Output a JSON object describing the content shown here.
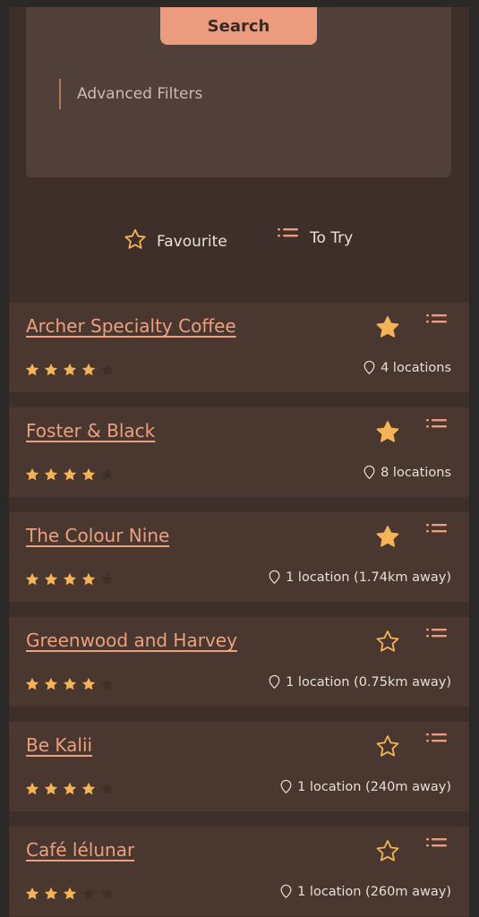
{
  "search": {
    "button_label": "Search",
    "advanced_filters_label": "Advanced Filters"
  },
  "filters": {
    "favourite_label": "Favourite",
    "to_try_label": "To Try"
  },
  "colors": {
    "accent": "#ec9c7e",
    "star_filled": "#f4b456",
    "star_empty": "#3e2f29",
    "card_bg": "#4a3830"
  },
  "cafes": [
    {
      "name": "Archer Specialty Coffee",
      "favourite": true,
      "rating": 4,
      "location": "4 locations"
    },
    {
      "name": "Foster & Black",
      "favourite": true,
      "rating": 4,
      "location": "8 locations"
    },
    {
      "name": "The Colour Nine",
      "favourite": true,
      "rating": 4,
      "location": "1 location (1.74km away)"
    },
    {
      "name": "Greenwood and Harvey",
      "favourite": false,
      "rating": 4,
      "location": "1 location (0.75km away)"
    },
    {
      "name": "Be Kalii",
      "favourite": false,
      "rating": 4,
      "location": "1 location (240m away)"
    },
    {
      "name": "Café lélunar",
      "favourite": false,
      "rating": 3,
      "location": "1 location (260m away)"
    }
  ]
}
